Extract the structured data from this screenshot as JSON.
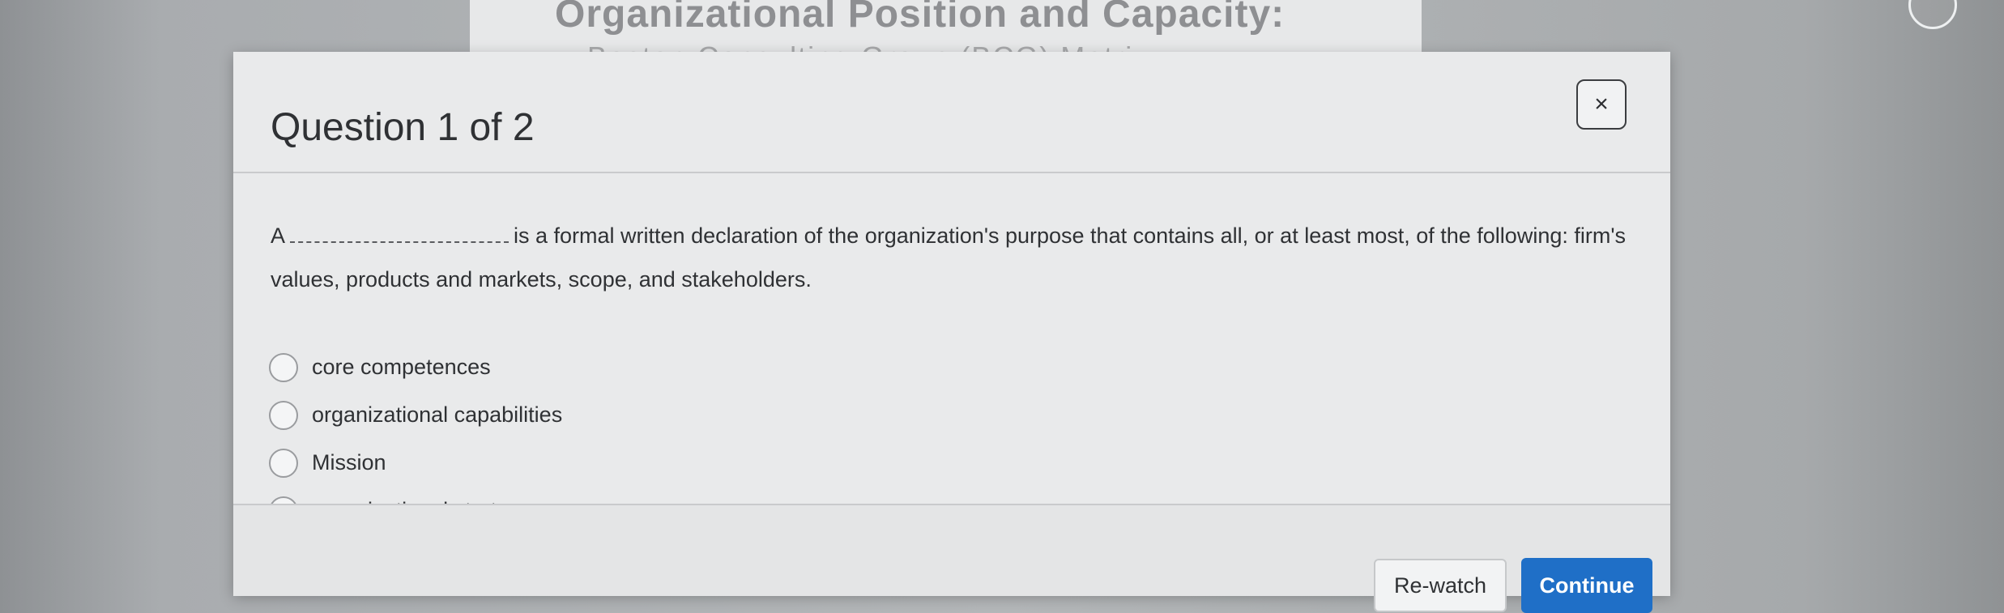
{
  "background": {
    "slide_title": "Organizational Position and Capacity:",
    "slide_subtitle": "Boston Consulting Group (BCG) Matrix"
  },
  "modal": {
    "title": "Question 1 of 2",
    "close_label": "×",
    "question": {
      "prefix": "A",
      "suffix": "is a formal written declaration of the organization's purpose that contains all, or at least most, of the following: firm's values, products and markets, scope, and stakeholders."
    },
    "options": [
      {
        "label": "core competences",
        "selected": false
      },
      {
        "label": "organizational capabilities",
        "selected": false
      },
      {
        "label": "Mission",
        "selected": false
      },
      {
        "label": "organizational strategy",
        "selected": false
      }
    ],
    "buttons": {
      "rewatch": "Re-watch",
      "continue": "Continue"
    }
  },
  "colors": {
    "accent": "#1f6fc7",
    "modal_background": "#e9eaeb",
    "text": "#2f3134"
  }
}
